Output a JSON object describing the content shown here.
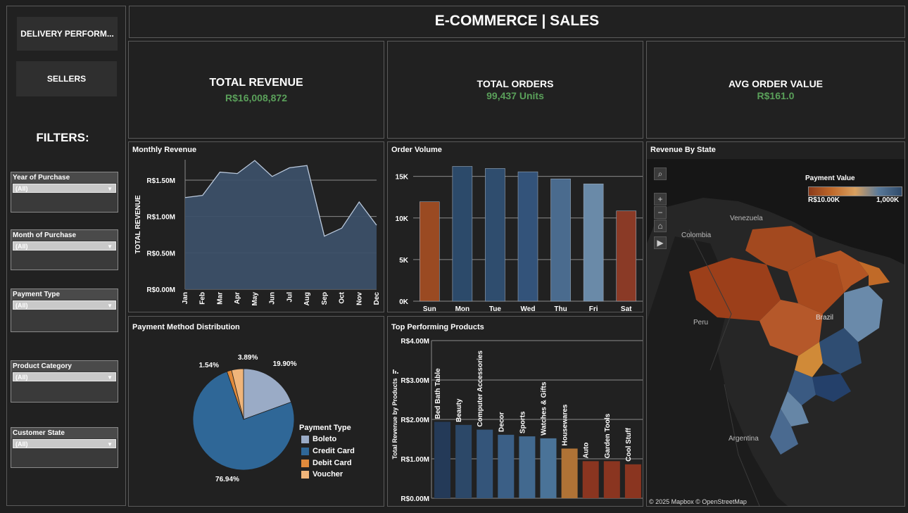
{
  "nav": {
    "delivery_label": "DELIVERY PERFORM...",
    "sellers_label": "SELLERS"
  },
  "filters": {
    "title": "FILTERS:",
    "items": [
      {
        "label": "Year of Purchase",
        "value": "(All)"
      },
      {
        "label": "Month of Purchase",
        "value": "(All)"
      },
      {
        "label": "Payment Type",
        "value": "(All)"
      },
      {
        "label": "Product Category",
        "value": "(All)"
      },
      {
        "label": "Customer State",
        "value": "(All)"
      }
    ]
  },
  "header": {
    "title": "E-COMMERCE | SALES"
  },
  "kpis": {
    "revenue": {
      "title": "TOTAL REVENUE",
      "value": "R$16,008,872"
    },
    "orders": {
      "title": "TOTAL ORDERS",
      "value": "99,437 Units"
    },
    "aov": {
      "title": "AVG ORDER VALUE",
      "value": "R$161.0"
    }
  },
  "colors": {
    "accent_green": "#5aa05a",
    "area_fill": "#3c5068",
    "line": "#b9c8dc"
  },
  "chart_data": [
    {
      "type": "area",
      "title": "Monthly Revenue",
      "ylabel": "TOTAL REVENUE",
      "xlabel": "",
      "categories": [
        "Jan",
        "Feb",
        "Mar",
        "Apr",
        "May",
        "Jun",
        "Jul",
        "Aug",
        "Sep",
        "Oct",
        "Nov",
        "Dec"
      ],
      "values": [
        1.26,
        1.29,
        1.61,
        1.59,
        1.77,
        1.55,
        1.67,
        1.7,
        0.73,
        0.84,
        1.2,
        0.88
      ],
      "yticks": [
        "R$0.00M",
        "R$0.50M",
        "R$1.00M",
        "R$1.50M"
      ],
      "ylim": [
        0,
        1.78
      ],
      "grid": true
    },
    {
      "type": "bar",
      "title": "Order Volume",
      "categories": [
        "Sun",
        "Mon",
        "Tue",
        "Wed",
        "Thu",
        "Fri",
        "Sat"
      ],
      "values": [
        11950,
        16200,
        15950,
        15550,
        14700,
        14100,
        10850
      ],
      "colors": [
        "#9a4a22",
        "#2c4a6a",
        "#2f4d6e",
        "#33537a",
        "#4a6b8e",
        "#6a8aa8",
        "#8a3a26"
      ],
      "yticks": [
        "0K",
        "5K",
        "10K",
        "15K"
      ],
      "ylim": [
        0,
        17000
      ],
      "grid": true
    },
    {
      "type": "pie",
      "title": "Payment Method Distribution",
      "legend_title": "Payment Type",
      "labels": [
        "Boleto",
        "Credit Card",
        "Debit Card",
        "Voucher"
      ],
      "values": [
        19.9,
        76.94,
        1.54,
        3.89
      ],
      "value_labels": [
        "19.90%",
        "76.94%",
        "1.54%",
        "3.89%"
      ],
      "colors": [
        "#9aabc6",
        "#2f6797",
        "#e08a3c",
        "#f0b57a"
      ]
    },
    {
      "type": "bar",
      "title": "Top Performing Products",
      "ylabel": "Total Revenue by Products",
      "categories": [
        "Bed Bath Table",
        "Beauty",
        "Computer Accessories",
        "Decor",
        "Sports",
        "Watches & Gifts",
        "Housewares",
        "Auto",
        "Garden Tools",
        "Cool Stuff"
      ],
      "values": [
        1.94,
        1.86,
        1.74,
        1.61,
        1.57,
        1.52,
        1.26,
        0.94,
        0.94,
        0.86
      ],
      "colors": [
        "#243a58",
        "#2c4868",
        "#34557a",
        "#3b5f86",
        "#42698f",
        "#4a7398",
        "#b07336",
        "#8a3520",
        "#8a3520",
        "#8a3520"
      ],
      "yticks": [
        "R$0.00M",
        "R$1.00M",
        "R$2.00M",
        "R$3.00M",
        "R$4.00M"
      ],
      "ylim": [
        0,
        4.0
      ],
      "grid": true
    }
  ],
  "map": {
    "title": "Revenue By State",
    "legend_title": "Payment Value",
    "legend_min": "R$10.00K",
    "legend_max": "1,000K",
    "labels": [
      "Venezuela",
      "Colombia",
      "Peru",
      "Brazil",
      "Argentina"
    ],
    "attribution": "© 2025 Mapbox  © OpenStreetMap",
    "gradient": [
      "#8a3a1a",
      "#c0692a",
      "#d8a060",
      "#5a7a9a",
      "#2f4a6a"
    ]
  }
}
